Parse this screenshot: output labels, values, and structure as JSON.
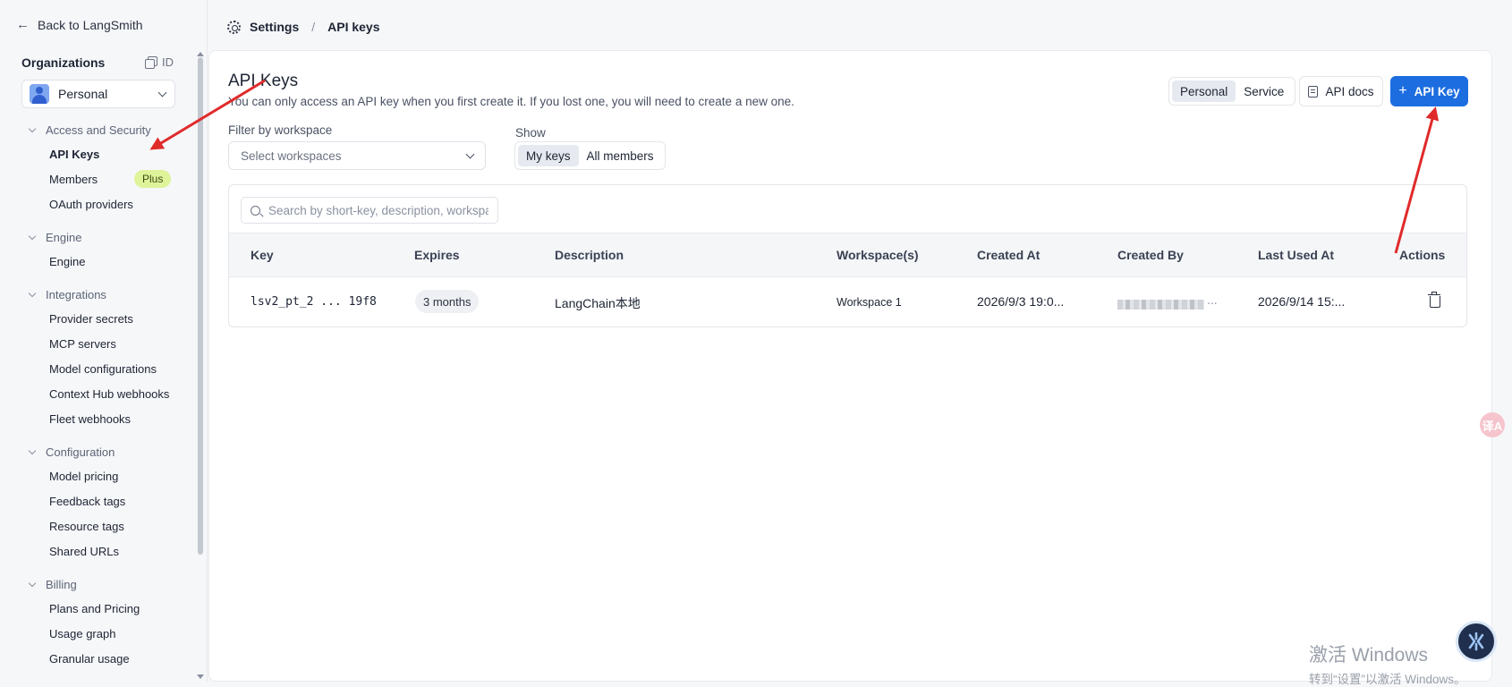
{
  "sidebar": {
    "back_label": "Back to LangSmith",
    "org_label": "Organizations",
    "id_label": "ID",
    "org_selected": "Personal",
    "groups": [
      {
        "title": "Access and Security",
        "items": [
          "API Keys",
          "Members",
          "OAuth providers"
        ]
      },
      {
        "title": "Engine",
        "items": [
          "Engine"
        ]
      },
      {
        "title": "Integrations",
        "items": [
          "Provider secrets",
          "MCP servers",
          "Model configurations",
          "Context Hub webhooks",
          "Fleet webhooks"
        ]
      },
      {
        "title": "Configuration",
        "items": [
          "Model pricing",
          "Feedback tags",
          "Resource tags",
          "Shared URLs"
        ]
      },
      {
        "title": "Billing",
        "items": [
          "Plans and Pricing",
          "Usage graph",
          "Granular usage"
        ]
      }
    ],
    "members_badge": "Plus",
    "active_item": "API Keys"
  },
  "breadcrumb": {
    "settings": "Settings",
    "separator": "/",
    "current": "API keys"
  },
  "main": {
    "title": "API Keys",
    "subtitle": "You can only access an API key when you first create it. If you lost one, you will need to create a new one.",
    "key_type_tabs": [
      "Personal",
      "Service"
    ],
    "key_type_selected": "Personal",
    "api_docs_label": "API docs",
    "add_key_label": "API Key",
    "filter_label": "Filter by workspace",
    "workspace_placeholder": "Select workspaces",
    "show_label": "Show",
    "show_tabs": [
      "My keys",
      "All members"
    ],
    "show_selected": "My keys",
    "search_placeholder": "Search by short-key, description, workspace"
  },
  "table": {
    "columns": [
      "Key",
      "Expires",
      "Description",
      "Workspace(s)",
      "Created At",
      "Created By",
      "Last Used At",
      "Actions"
    ],
    "rows": [
      {
        "key": "lsv2_pt_2 ... 19f8",
        "expires": "3 months",
        "description": "LangChain本地",
        "workspace": "Workspace 1",
        "created_at": "2026/9/3 19:0...",
        "created_by": "...",
        "last_used_at": "2026/9/14 15:..."
      }
    ]
  },
  "overlay": {
    "translate_label": "译A",
    "watermark_line1": "激活 Windows",
    "watermark_line2": "转到“设置”以激活 Windows。"
  },
  "colors": {
    "accent": "#1c6de0",
    "annotation_arrow": "#e02a2a",
    "plus_badge": "#dff39a"
  }
}
